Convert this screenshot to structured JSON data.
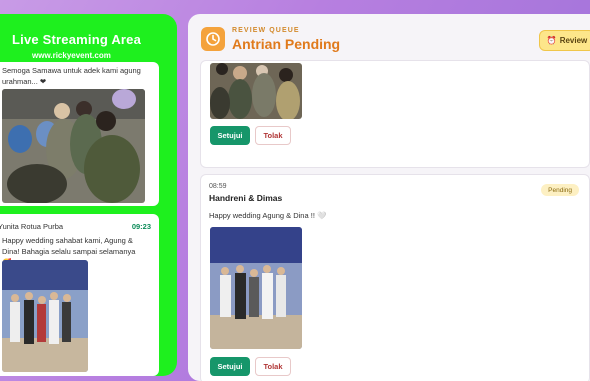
{
  "live": {
    "title": "Live Streaming Area",
    "url": "www.rickyevent.com",
    "card1_text": "Semoga Samawa untuk adek kami agung urahman... ❤",
    "card2": {
      "name": "Yunita Rotua Purba",
      "time": "09:23",
      "text": "Happy wedding sahabat kami, Agung & Dina! Bahagia selalu sampai selamanya 🥰"
    }
  },
  "queue": {
    "subtitle": "REVIEW QUEUE",
    "title": "Antrian Pending",
    "review_label": "Review",
    "items": [
      {
        "approve": "Setujui",
        "reject": "Tolak"
      },
      {
        "time": "08:59",
        "name": "Handreni & Dimas",
        "message": "Happy wedding Agung & Dina !! 🤍",
        "status": "Pending",
        "approve": "Setujui",
        "reject": "Tolak"
      }
    ]
  },
  "colors": {
    "live_bg": "#1ef01e",
    "accent": "#e07a1c",
    "approve": "#16966a",
    "reject": "#b03535",
    "badge": "#fdf0c3"
  },
  "icons": [
    "clock-icon",
    "alarm-clock-icon"
  ]
}
